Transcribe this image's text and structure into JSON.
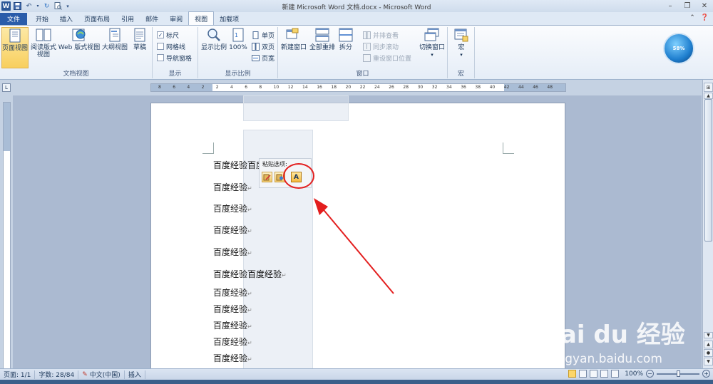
{
  "titlebar": {
    "title": "新建 Microsoft Word 文档.docx - Microsoft Word",
    "app_logo": "W"
  },
  "tabs": [
    {
      "label": "文件"
    },
    {
      "label": "开始"
    },
    {
      "label": "插入"
    },
    {
      "label": "页面布局"
    },
    {
      "label": "引用"
    },
    {
      "label": "邮件"
    },
    {
      "label": "审阅"
    },
    {
      "label": "视图"
    },
    {
      "label": "加载项"
    }
  ],
  "ribbon": {
    "views_group": {
      "label": "文档视图",
      "buttons": [
        "页面视图",
        "阅读版式\n视图",
        "Web 版式视图",
        "大纲视图",
        "草稿"
      ]
    },
    "show_group": {
      "label": "显示",
      "ruler": "标尺",
      "gridlines": "网格线",
      "nav_pane": "导航窗格"
    },
    "zoom_group": {
      "label": "显示比例",
      "zoom": "显示比例",
      "hundred": "100%",
      "one_page": "单页",
      "two_pages": "双页",
      "page_width": "页宽"
    },
    "window_group": {
      "label": "窗口",
      "new_window": "新建窗口",
      "arrange_all": "全部重排",
      "split": "拆分",
      "side_by_side": "并排查看",
      "sync_scroll": "同步滚动",
      "reset_position": "重设窗口位置",
      "switch_windows": "切换窗口"
    },
    "macros_group": {
      "label": "宏",
      "macros": "宏"
    },
    "orb_text": "58%"
  },
  "ruler_ticks": [
    "8",
    "6",
    "4",
    "2",
    "2",
    "4",
    "6",
    "8",
    "10",
    "12",
    "14",
    "16",
    "18",
    "20",
    "22",
    "24",
    "26",
    "28",
    "30",
    "32",
    "34",
    "36",
    "38",
    "40",
    "42",
    "44",
    "46",
    "48"
  ],
  "document": {
    "lines": [
      "百度经验百度",
      "百度经验",
      "百度经验",
      "百度经验",
      "百度经验",
      "百度经验百度经验",
      "百度经验",
      "百度经验",
      "百度经验",
      "百度经验",
      "百度经验"
    ]
  },
  "paste_popup": {
    "title": "粘贴选项:",
    "options": [
      "keep-source-formatting",
      "merge-formatting",
      "keep-text-only"
    ],
    "text_only_glyph": "A"
  },
  "statusbar": {
    "page": "页面: 1/1",
    "words": "字数: 28/84",
    "language": "中文(中国)",
    "mode": "插入",
    "zoom": "100%"
  },
  "watermark": {
    "main": "Bai du 经验",
    "sub": "jingyan.baidu.com"
  },
  "colors": {
    "file_tab": "#2a5caa",
    "active_view": "#f8cf5e",
    "annotation": "#e31e1e"
  }
}
